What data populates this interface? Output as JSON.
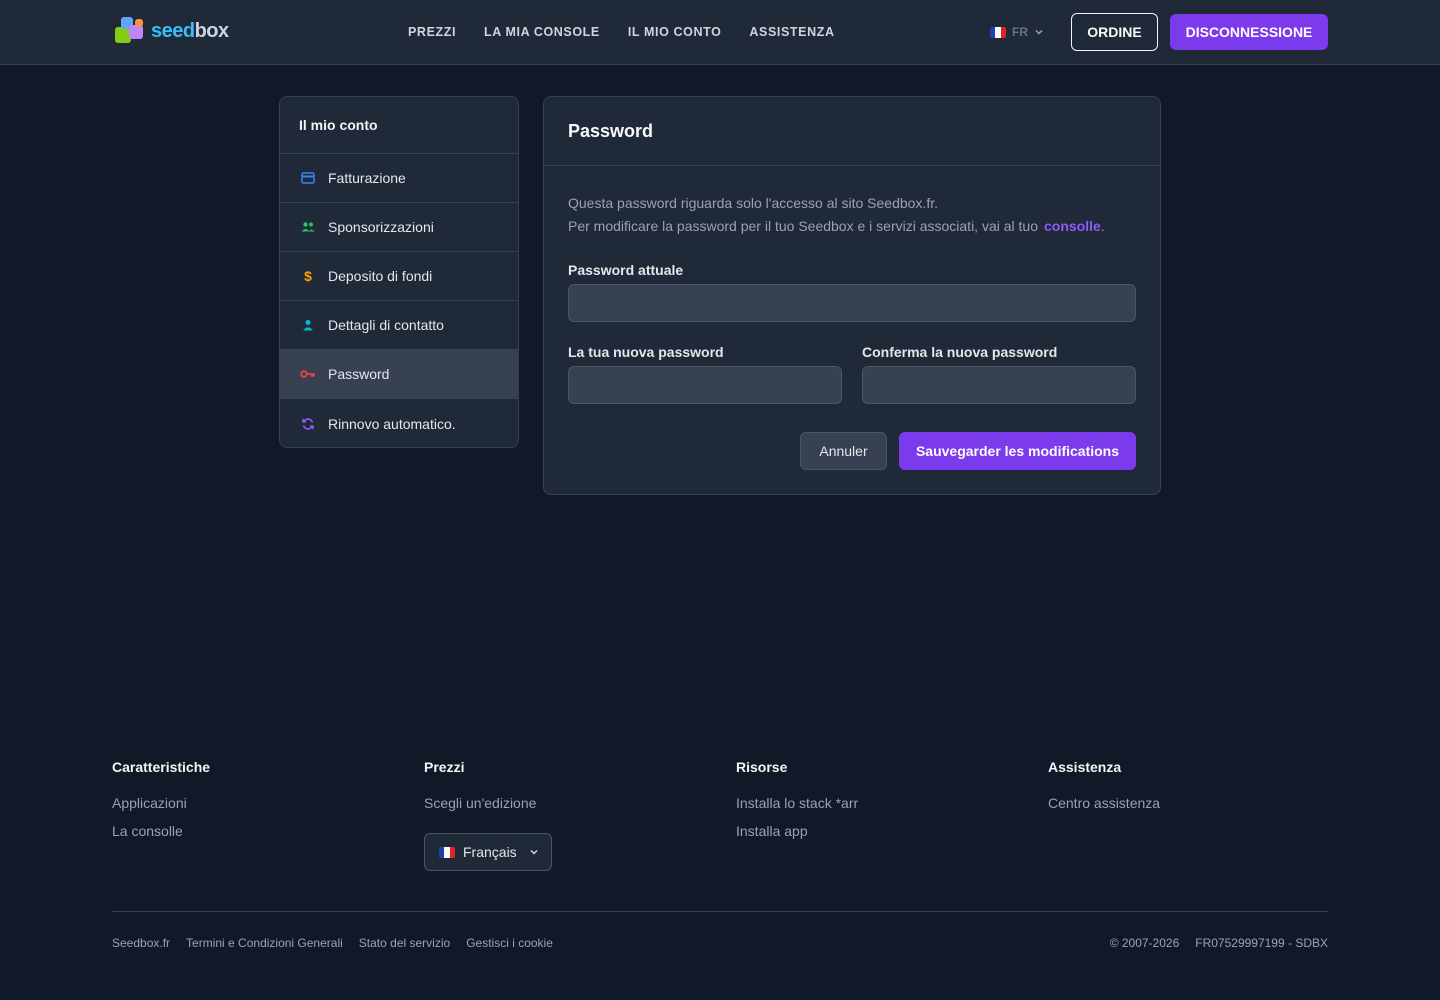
{
  "header": {
    "logo": {
      "text_a": "seed",
      "text_b": "box"
    },
    "nav": [
      {
        "label": "PREZZI"
      },
      {
        "label": "LA MIA CONSOLE"
      },
      {
        "label": "IL MIO CONTO"
      },
      {
        "label": "ASSISTENZA"
      }
    ],
    "language": {
      "code": "FR"
    },
    "order_label": "ORDINE",
    "logout_label": "DISCONNESSIONE"
  },
  "sidebar": {
    "title": "Il mio conto",
    "items": [
      {
        "label": "Fatturazione",
        "icon": "credit-card-icon",
        "color": "#3b82f6"
      },
      {
        "label": "Sponsorizzazioni",
        "icon": "users-icon",
        "color": "#22c55e"
      },
      {
        "label": "Deposito di fondi",
        "icon": "dollar-icon",
        "color": "#f59e0b"
      },
      {
        "label": "Dettagli di contatto",
        "icon": "user-icon",
        "color": "#06b6d4"
      },
      {
        "label": "Password",
        "icon": "key-icon",
        "color": "#ef4444",
        "active": true
      },
      {
        "label": "Rinnovo automatico.",
        "icon": "refresh-icon",
        "color": "#8b5cf6"
      }
    ]
  },
  "panel": {
    "title": "Password",
    "info_line1": "Questa password riguarda solo l'accesso al sito Seedbox.fr.",
    "info_line2": "Per modificare la password per il tuo Seedbox e i servizi associati, vai al tuo",
    "info_link": "consolle",
    "current_label": "Password attuale",
    "current_value": "",
    "new_label": "La tua nuova password",
    "new_value": "",
    "confirm_label": "Conferma la nuova password",
    "confirm_value": "",
    "cancel_label": "Annuler",
    "save_label": "Sauvegarder les modifications"
  },
  "footer": {
    "columns": [
      {
        "title": "Caratteristiche",
        "links": [
          "Applicazioni",
          "La consolle"
        ]
      },
      {
        "title": "Prezzi",
        "links": [
          "Scegli un'edizione"
        ]
      },
      {
        "title": "Risorse",
        "links": [
          "Installa lo stack *arr",
          "Installa app"
        ]
      },
      {
        "title": "Assistenza",
        "links": [
          "Centro assistenza"
        ]
      }
    ],
    "language_select": "Français",
    "legal_links": [
      "Seedbox.fr",
      "Termini e Condizioni Generali",
      "Stato del servizio",
      "Gestisci i cookie"
    ],
    "copyright": "© 2007-2026",
    "company_id": "FR07529997199 - SDBX"
  },
  "colors": {
    "accent": "#7c3aed",
    "background": "#111827",
    "surface": "#1f2937"
  }
}
